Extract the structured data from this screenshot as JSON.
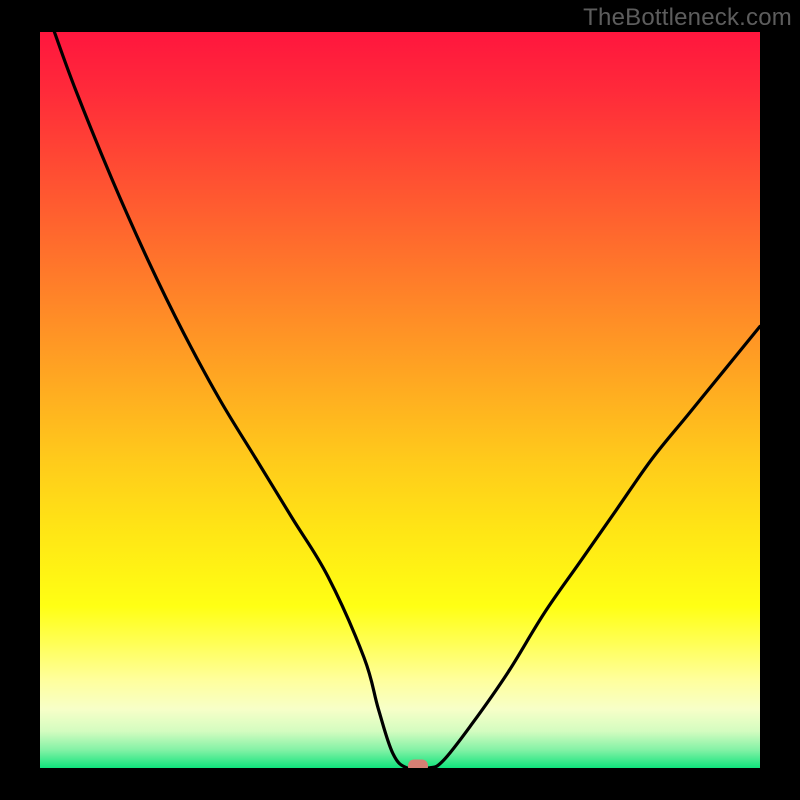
{
  "watermark": "TheBottleneck.com",
  "colors": {
    "bg_black": "#000000",
    "grad_stops": [
      {
        "offset": 0.0,
        "color": "#ff163e"
      },
      {
        "offset": 0.08,
        "color": "#ff2a3a"
      },
      {
        "offset": 0.18,
        "color": "#ff4a33"
      },
      {
        "offset": 0.28,
        "color": "#ff6a2d"
      },
      {
        "offset": 0.38,
        "color": "#ff8a27"
      },
      {
        "offset": 0.48,
        "color": "#ffaa21"
      },
      {
        "offset": 0.58,
        "color": "#ffca1b"
      },
      {
        "offset": 0.68,
        "color": "#ffe615"
      },
      {
        "offset": 0.78,
        "color": "#ffff14"
      },
      {
        "offset": 0.83,
        "color": "#ffff55"
      },
      {
        "offset": 0.88,
        "color": "#ffff9c"
      },
      {
        "offset": 0.92,
        "color": "#f7ffc8"
      },
      {
        "offset": 0.95,
        "color": "#d4fcc0"
      },
      {
        "offset": 0.975,
        "color": "#85f2a6"
      },
      {
        "offset": 1.0,
        "color": "#10e37c"
      }
    ],
    "curve": "#000000",
    "marker": "#d67f74",
    "watermark_text": "#5d5d5d"
  },
  "chart_data": {
    "type": "line",
    "title": "",
    "xlabel": "",
    "ylabel": "",
    "xlim": [
      0,
      100
    ],
    "ylim": [
      0,
      100
    ],
    "series": [
      {
        "name": "bottleneck-curve",
        "x": [
          2,
          5,
          10,
          15,
          20,
          25,
          30,
          35,
          40,
          45,
          47,
          49,
          51,
          54,
          56,
          60,
          65,
          70,
          75,
          80,
          85,
          90,
          95,
          100
        ],
        "y": [
          100,
          92,
          80,
          69,
          59,
          50,
          42,
          34,
          26,
          15,
          8,
          2,
          0,
          0,
          1,
          6,
          13,
          21,
          28,
          35,
          42,
          48,
          54,
          60
        ]
      }
    ],
    "marker": {
      "x": 52.5,
      "y": 0,
      "shape": "rounded-pill"
    },
    "background": "vertical-gradient-red-yellow-green",
    "axes_visible": false
  }
}
